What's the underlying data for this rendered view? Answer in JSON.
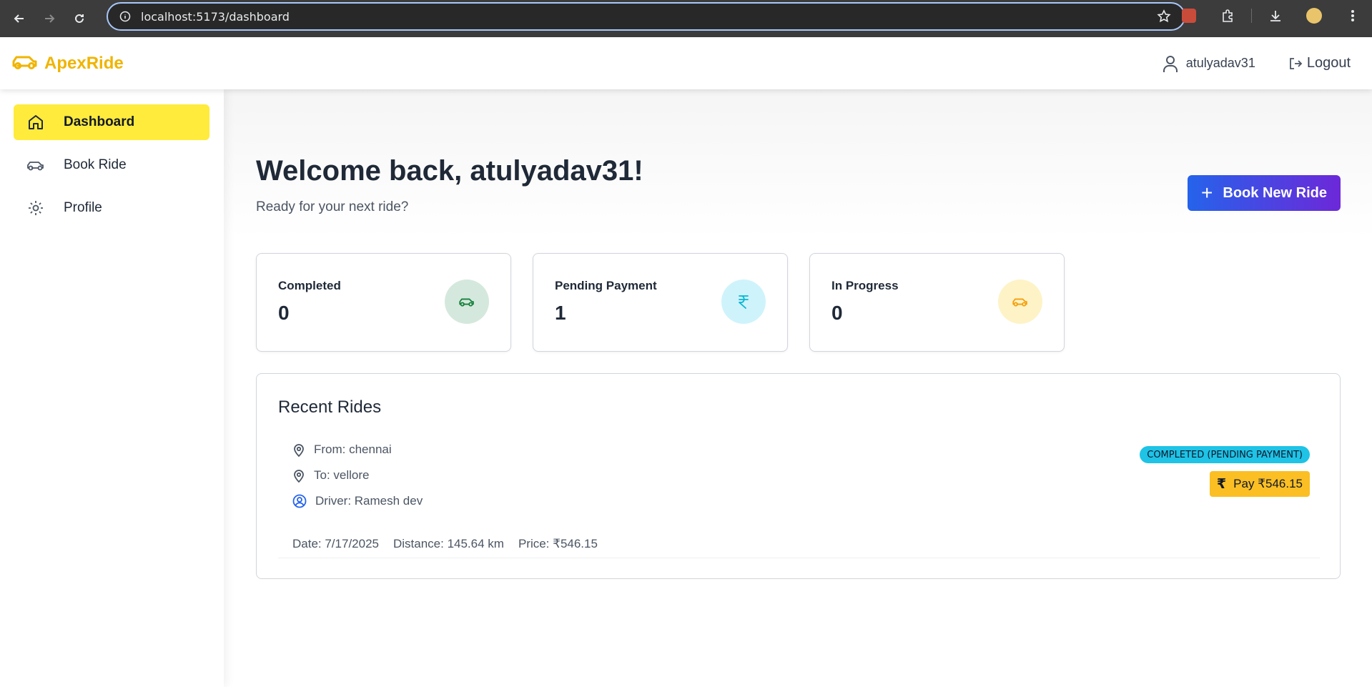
{
  "browser": {
    "url": "localhost:5173/dashboard"
  },
  "header": {
    "brand": "ApexRide",
    "username": "atulyadav31",
    "logout_label": "Logout"
  },
  "sidebar": {
    "items": [
      {
        "label": "Dashboard",
        "icon": "home-icon",
        "active": true
      },
      {
        "label": "Book Ride",
        "icon": "car-icon",
        "active": false
      },
      {
        "label": "Profile",
        "icon": "gear-icon",
        "active": false
      }
    ]
  },
  "main": {
    "welcome": "Welcome back, atulyadav31!",
    "subtitle": "Ready for your next ride?",
    "book_button": "Book New Ride",
    "stats": [
      {
        "label": "Completed",
        "value": "0",
        "icon": "car-icon",
        "color": "#15803d"
      },
      {
        "label": "Pending Payment",
        "value": "1",
        "icon": "rupee-icon",
        "color": "#06b6d4"
      },
      {
        "label": "In Progress",
        "value": "0",
        "icon": "car-icon",
        "color": "#f59e0b"
      }
    ],
    "recent": {
      "title": "Recent Rides",
      "rides": [
        {
          "from": "From: chennai",
          "to": "To: vellore",
          "driver": "Driver: Ramesh dev",
          "date": "Date: 7/17/2025",
          "distance": "Distance: 145.64 km",
          "price": "Price: ₹546.15",
          "status": "COMPLETED (PENDING PAYMENT)",
          "pay_label": "Pay ₹546.15"
        }
      ]
    }
  },
  "colors": {
    "brand": "#f0b400",
    "active_nav": "#ffeb3b",
    "button_gradient_start": "#2563eb",
    "button_gradient_end": "#6d28d9",
    "status_badge": "#1ec3e6",
    "pay_button": "#fbbf24"
  }
}
